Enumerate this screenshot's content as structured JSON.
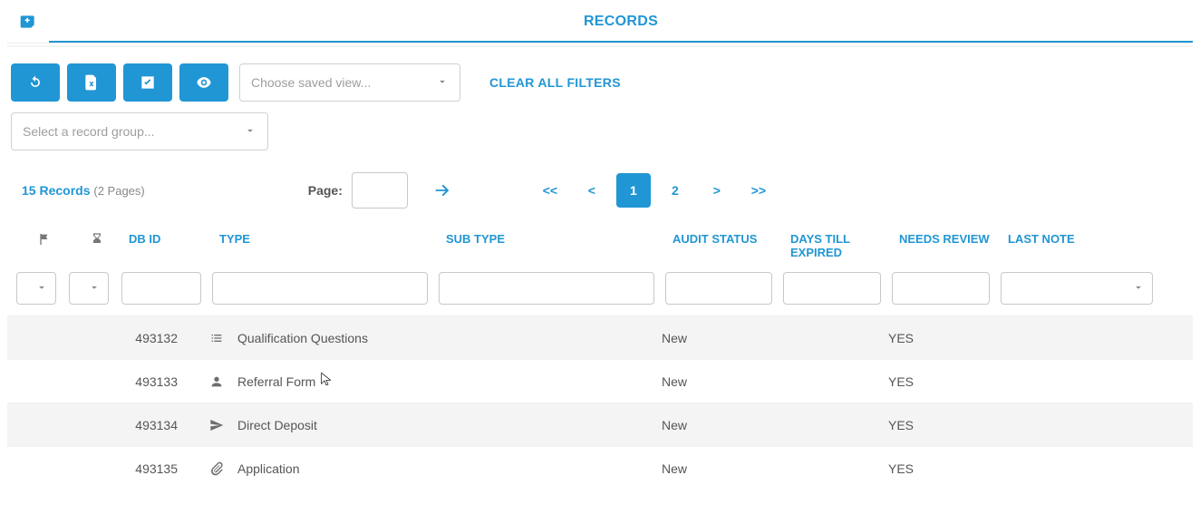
{
  "header": {
    "tab_label": "RECORDS"
  },
  "toolbar": {
    "saved_view_placeholder": "Choose saved view...",
    "clear_filters": "CLEAR ALL FILTERS",
    "record_group_placeholder": "Select a record group..."
  },
  "pager": {
    "count_text": "15 Records",
    "pages_text": "(2 Pages)",
    "page_label": "Page:",
    "first": "<<",
    "prev": "<",
    "next": ">",
    "last": ">>",
    "page1": "1",
    "page2": "2"
  },
  "columns": {
    "dbid": "DB ID",
    "type": "TYPE",
    "subtype": "SUB TYPE",
    "audit": "AUDIT STATUS",
    "days": "DAYS TILL EXPIRED",
    "needs": "NEEDS REVIEW",
    "note": "LAST NOTE"
  },
  "rows": [
    {
      "dbid": "493132",
      "type_icon": "list-icon",
      "type": "Qualification Questions",
      "audit": "New",
      "needs": "YES"
    },
    {
      "dbid": "493133",
      "type_icon": "person-icon",
      "type": "Referral Form",
      "audit": "New",
      "needs": "YES"
    },
    {
      "dbid": "493134",
      "type_icon": "send-icon",
      "type": "Direct Deposit",
      "audit": "New",
      "needs": "YES"
    },
    {
      "dbid": "493135",
      "type_icon": "paperclip-icon",
      "type": "Application",
      "audit": "New",
      "needs": "YES"
    }
  ]
}
